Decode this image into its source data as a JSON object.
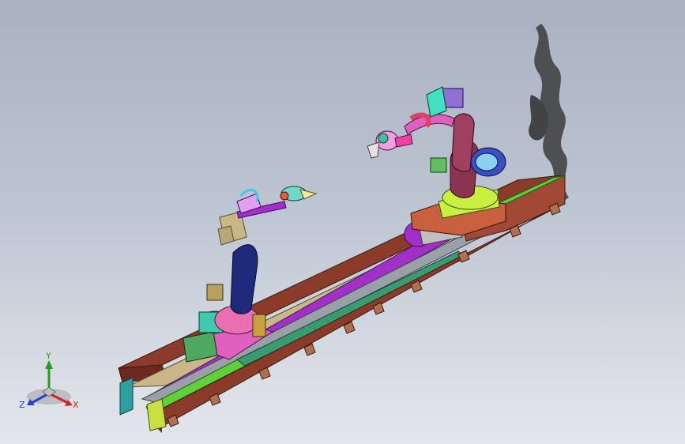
{
  "viewport": {
    "background_top": "#a9b2c1",
    "background_bottom": "#e3e6ec"
  },
  "model": {
    "parts": [
      "track-rail-base",
      "robot-arm-left",
      "robot-arm-right",
      "sliding-carriage",
      "smoke-artifact"
    ],
    "colors": {
      "rail_brown": "#8a3b2a",
      "rail_green": "#5fcf3a",
      "rail_teal": "#2fa0a0",
      "purple": "#a030c8",
      "robot_navy": "#1f2a7a",
      "robot_maroon": "#8a3550",
      "robot_lime": "#c8f040",
      "motor_teal": "#40c8b0",
      "pink": "#e060c0",
      "khaki": "#c8b888"
    }
  },
  "triad": {
    "x_label": "X",
    "y_label": "Y",
    "z_label": "Z",
    "x_color": "#d42020",
    "y_color": "#20a020",
    "z_color": "#2040d0"
  }
}
